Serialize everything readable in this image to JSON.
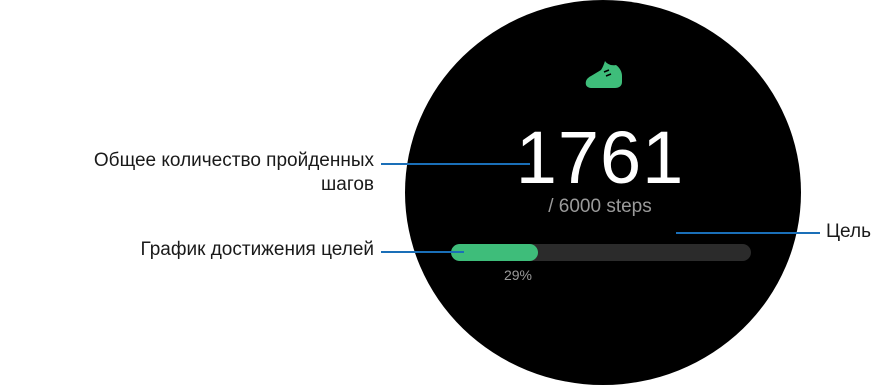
{
  "watch": {
    "icon": "running-shoe-icon",
    "step_count": "1761",
    "goal_text": "/ 6000 steps",
    "progress_fraction": 0.29,
    "progress_text": "29%",
    "colors": {
      "face": "#000000",
      "accent": "#3ebd7a",
      "secondary_text": "#9a9a9a",
      "track": "#2b2b2b"
    }
  },
  "callouts": {
    "total_steps_line1": "Общее количество пройденных",
    "total_steps_line2": "шагов",
    "goal_progress": "График достижения целей",
    "goal": "Цель",
    "leader_color": "#1a6fb8"
  }
}
